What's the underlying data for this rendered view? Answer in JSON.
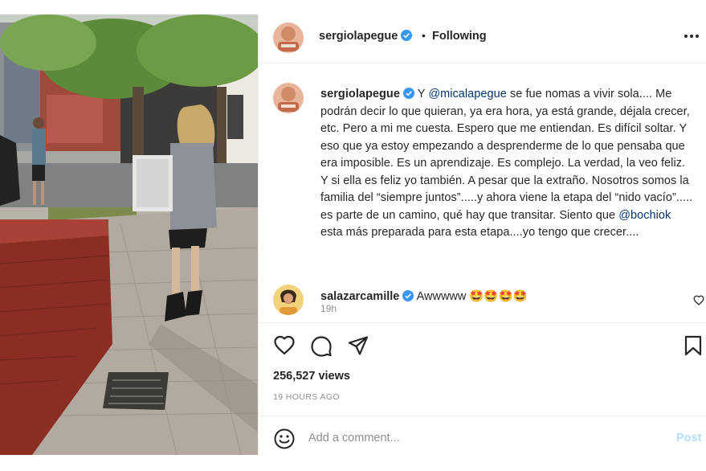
{
  "header": {
    "username": "sergiolapegue",
    "separator": "•",
    "follow_status": "Following"
  },
  "caption": {
    "username": "sergiolapegue",
    "text_1": " Y ",
    "mention_1": "@micalapegue",
    "text_2": " se fue nomas a vivir sola.... Me podrán decir lo que quieran, ya era hora, ya está grande, déjala crecer, etc. Pero a mi me cuesta. Espero que me entiendan. Es difícil soltar. Y eso que ya estoy empezando a desprenderme de lo que pensaba que era imposible. Es un aprendizaje. Es complejo. La verdad, la veo feliz. Y si ella es feliz yo también. A pesar que la extraño. Nosotros somos la familia del “siempre juntos”.....y ahora viene la etapa del “nido vacío”..... es parte de un camino, qué hay que transitar. Siento que ",
    "mention_2": "@bochiok",
    "text_3": " esta más preparada para esta etapa....yo tengo que crecer....",
    "time": "19h"
  },
  "comment": {
    "username": "salazarcamille",
    "text": " Awwwww 🤩🤩🤩🤩"
  },
  "stats": {
    "views": "256,527 views",
    "time_ago": "19 HOURS AGO"
  },
  "add_comment": {
    "placeholder": "Add a comment...",
    "post_label": "Post"
  },
  "colors": {
    "verified": "#3897f0",
    "mention": "#00376b",
    "post_disabled": "#b2dffc",
    "muted": "#8e8e8e",
    "divider": "#efefef"
  },
  "icons": [
    "verified-badge-icon",
    "more-options-icon",
    "heart-icon",
    "comment-icon",
    "share-icon",
    "bookmark-icon",
    "emoji-icon"
  ]
}
